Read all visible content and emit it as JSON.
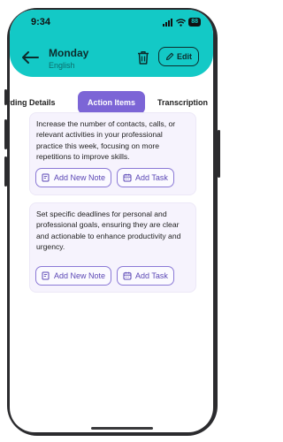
{
  "status_bar": {
    "time": "9:34",
    "battery": "88"
  },
  "header": {
    "title": "Monday",
    "subtitle": "English",
    "edit_label": "Edit"
  },
  "tabs": [
    {
      "label": "rding Details",
      "active": false
    },
    {
      "label": "Action Items",
      "active": true
    },
    {
      "label": "Transcription",
      "active": false
    }
  ],
  "action_items": [
    {
      "text": "Increase the number of contacts, calls, or relevant activities in your professional practice this week, focusing on more repetitions to improve skills.",
      "add_note_label": "Add New Note",
      "add_task_label": "Add Task"
    },
    {
      "text": "Set specific deadlines for personal and professional goals, ensuring they are clear and actionable to enhance productivity and urgency.",
      "add_note_label": "Add New Note",
      "add_task_label": "Add Task"
    }
  ],
  "colors": {
    "header": "#13c9c6",
    "accent": "#7c65d6",
    "card_bg": "#f6f3fd"
  }
}
